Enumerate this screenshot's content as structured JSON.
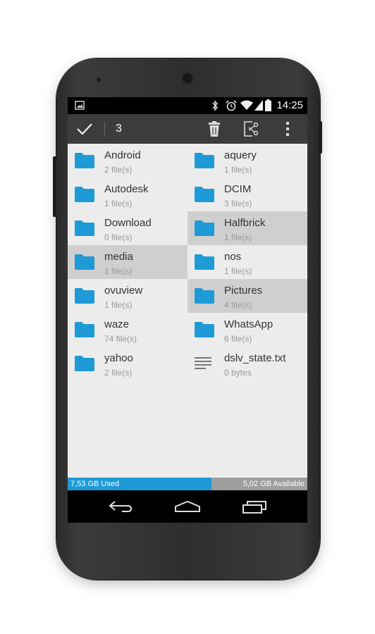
{
  "status_bar": {
    "time": "14:25"
  },
  "action_bar": {
    "selected_count": "3"
  },
  "files": [
    {
      "name": "Android",
      "meta": "2 file(s)",
      "type": "folder",
      "selected": false
    },
    {
      "name": "aquery",
      "meta": "1 file(s)",
      "type": "folder",
      "selected": false
    },
    {
      "name": "Autodesk",
      "meta": "1 file(s)",
      "type": "folder",
      "selected": false
    },
    {
      "name": "DCIM",
      "meta": "3 file(s)",
      "type": "folder",
      "selected": false
    },
    {
      "name": "Download",
      "meta": "0 file(s)",
      "type": "folder",
      "selected": false
    },
    {
      "name": "Halfbrick",
      "meta": "1 file(s)",
      "type": "folder",
      "selected": true
    },
    {
      "name": "media",
      "meta": "1 file(s)",
      "type": "folder",
      "selected": true
    },
    {
      "name": "nos",
      "meta": "1 file(s)",
      "type": "folder",
      "selected": false
    },
    {
      "name": "ovuview",
      "meta": "1 file(s)",
      "type": "folder",
      "selected": false
    },
    {
      "name": "Pictures",
      "meta": "4 file(s)",
      "type": "folder",
      "selected": true
    },
    {
      "name": "waze",
      "meta": "74 file(s)",
      "type": "folder",
      "selected": false
    },
    {
      "name": "WhatsApp",
      "meta": "6 file(s)",
      "type": "folder",
      "selected": false
    },
    {
      "name": "yahoo",
      "meta": "2 file(s)",
      "type": "folder",
      "selected": false
    },
    {
      "name": "dslv_state.txt",
      "meta": "0 bytes",
      "type": "text-file",
      "selected": false
    }
  ],
  "storage": {
    "used_label": "7,53 GB Used",
    "available_label": "5,02 GB Available",
    "used_fraction": 0.6
  },
  "colors": {
    "accent": "#1e9ad6",
    "folder": "#1e9ad6",
    "actionbar": "#3c3c3c",
    "selected_row": "#cfcfcf"
  }
}
